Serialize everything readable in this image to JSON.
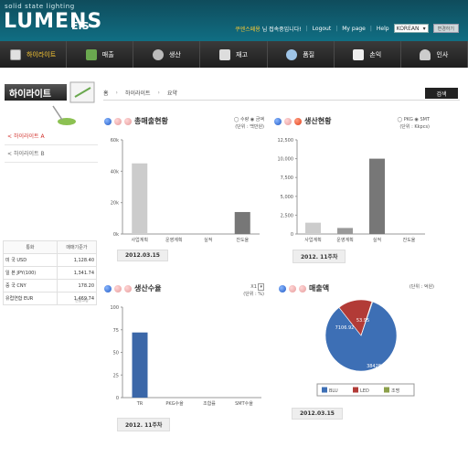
{
  "header": {
    "logo_small": "solid state lighting",
    "logo_big": "LUMENS",
    "logo_sub": "EIS",
    "welcome_name": "쿠엔스페용",
    "welcome_text": "님 접속중입니다!",
    "links": [
      "Logout",
      "My page",
      "Help"
    ],
    "language": "KOREAN",
    "lang_button": "변경하기"
  },
  "nav": {
    "items": [
      {
        "label": "하이라이트",
        "active": true
      },
      {
        "label": "매출",
        "active": false
      },
      {
        "label": "생산",
        "active": false
      },
      {
        "label": "재고",
        "active": false
      },
      {
        "label": "품질",
        "active": false
      },
      {
        "label": "손익",
        "active": false
      },
      {
        "label": "인사",
        "active": false
      }
    ]
  },
  "sidebar": {
    "banner": "하이라이트",
    "menu": [
      {
        "label": "하이라이트 A",
        "active": true
      },
      {
        "label": "하이라이트 B",
        "active": false
      }
    ],
    "rates": {
      "headers": [
        "통화",
        "매매기준가"
      ],
      "rows": [
        [
          "미 국 USD",
          "1,128.40"
        ],
        [
          "일 본 JPY(100)",
          "1,341.74"
        ],
        [
          "중 국 CNY",
          "178.20"
        ],
        [
          "유럽연합 EUR",
          "1,469.74"
        ]
      ],
      "note": "신용고정"
    }
  },
  "breadcrumb": {
    "items": [
      "홈",
      "하이라이트",
      "요약"
    ],
    "search_label": "검색"
  },
  "panels": {
    "sales": {
      "title": "총매출현황",
      "option": "◯ 수량 ◉ 금액",
      "unit": "(단위 : 백만원)",
      "date": "2012.03.15"
    },
    "production": {
      "title": "생산현황",
      "option": "◯ PKG ◉ SMT",
      "unit": "(단위 : Kkpcs)",
      "date": "2012. 11주차"
    },
    "yield": {
      "title": "생산수율",
      "option": "X1",
      "unit": "(단위 : %)",
      "date": "2012. 11주차"
    },
    "revenue": {
      "title": "매출액",
      "unit": "(단위 : 억원)",
      "date": "2012.03.15"
    }
  },
  "chart_data": [
    {
      "type": "bar",
      "categories": [
        "사업계획",
        "운영계획",
        "실적",
        "잔도율"
      ],
      "values": [
        45,
        0,
        0,
        14
      ],
      "colors": [
        "#cccccc",
        "#cccccc",
        "#cccccc",
        "#777777"
      ],
      "ylim": [
        0,
        60
      ],
      "yticks": [
        "0k",
        "20k",
        "40k",
        "60k"
      ]
    },
    {
      "type": "bar",
      "categories": [
        "사업계획",
        "운영계획",
        "실적",
        "잔도율"
      ],
      "values": [
        1500,
        800,
        10000,
        0
      ],
      "colors": [
        "#cccccc",
        "#999999",
        "#777777",
        "#cccccc"
      ],
      "ylim": [
        0,
        12500
      ],
      "yticks": [
        "0",
        "2,500",
        "5,000",
        "7,500",
        "10,000",
        "12,500"
      ]
    },
    {
      "type": "bar",
      "categories": [
        "TR",
        "PKG수율",
        "조합률",
        "SMT수율"
      ],
      "values": [
        72,
        0,
        0,
        0
      ],
      "colors": [
        "#3b67a8",
        "#3b67a8",
        "#3b67a8",
        "#3b67a8"
      ],
      "ylim": [
        0,
        100
      ],
      "yticks": [
        "0",
        "25",
        "50",
        "75",
        "100"
      ]
    },
    {
      "type": "pie",
      "labels": [
        "BLU",
        "LED",
        "조명"
      ],
      "values": [
        38428.96,
        7106.92,
        53.95
      ],
      "value_labels": [
        "38428.96",
        "7106.92",
        "53.95"
      ],
      "colors": [
        "#3d6fb5",
        "#b23b37",
        "#8ca04a"
      ]
    }
  ]
}
